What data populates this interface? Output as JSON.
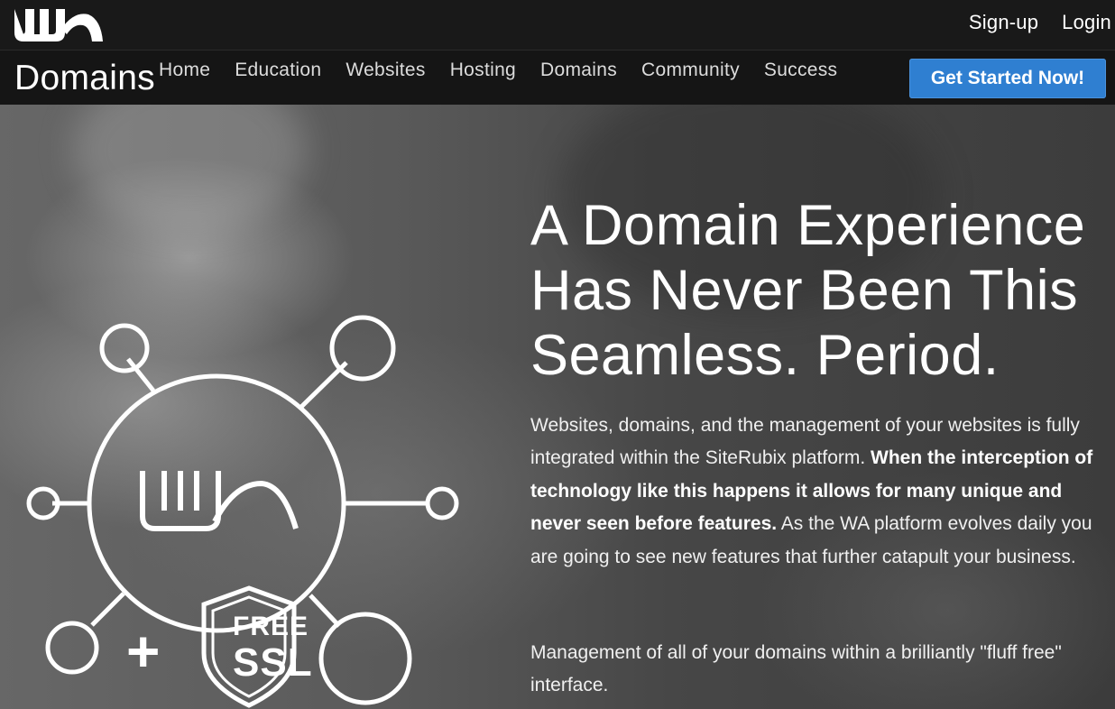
{
  "header": {
    "logo_text": "WA",
    "links": {
      "signup": "Sign-up",
      "login": "Login"
    }
  },
  "nav": {
    "brand": "Domains",
    "items": [
      "Home",
      "Education",
      "Websites",
      "Hosting",
      "Domains",
      "Community",
      "Success"
    ],
    "cta": "Get Started Now!"
  },
  "hero": {
    "headline": "A Domain Experience Has Never Been This Seamless. Period.",
    "paragraph1": {
      "start": "Websites, domains, and the management of your websites is fully integrated within the SiteRubix platform. ",
      "bold": "When the interception of technology like this happens it allows for many unique and never seen before features.",
      "end": " As the WA platform evolves daily you are going to see new features that further catapult your business."
    },
    "paragraph2": "Management of all of your domains within a brilliantly \"fluff free\" interface.",
    "hub_logo_text": "WA",
    "plus": "+",
    "ssl": {
      "free": "FREE",
      "ssl": "SSL"
    }
  },
  "colors": {
    "cta": "#2f7fd1",
    "topbar": "#191919",
    "navbar": "#151515"
  }
}
